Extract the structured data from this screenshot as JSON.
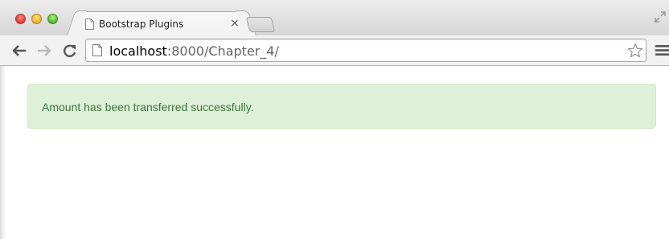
{
  "browser": {
    "tab": {
      "title": "Bootstrap Plugins",
      "close_glyph": "×"
    },
    "address_bar": {
      "host": "localhost",
      "path": ":8000/Chapter_4/"
    },
    "icons": {
      "close_window": "red-traffic-light",
      "minimize_window": "yellow-traffic-light",
      "maximize_window": "green-traffic-light",
      "back": "arrow-left-icon",
      "forward": "arrow-right-icon",
      "reload": "reload-icon",
      "bookmark": "star-icon",
      "menu": "hamburger-menu-icon",
      "fullscreen": "fullscreen-icon"
    }
  },
  "page": {
    "alert": {
      "text": "Amount has been transferred successfully.",
      "type": "success",
      "colors": {
        "background": "#dff0d8",
        "border": "#d6e9c6",
        "text": "#3c763d"
      }
    }
  }
}
